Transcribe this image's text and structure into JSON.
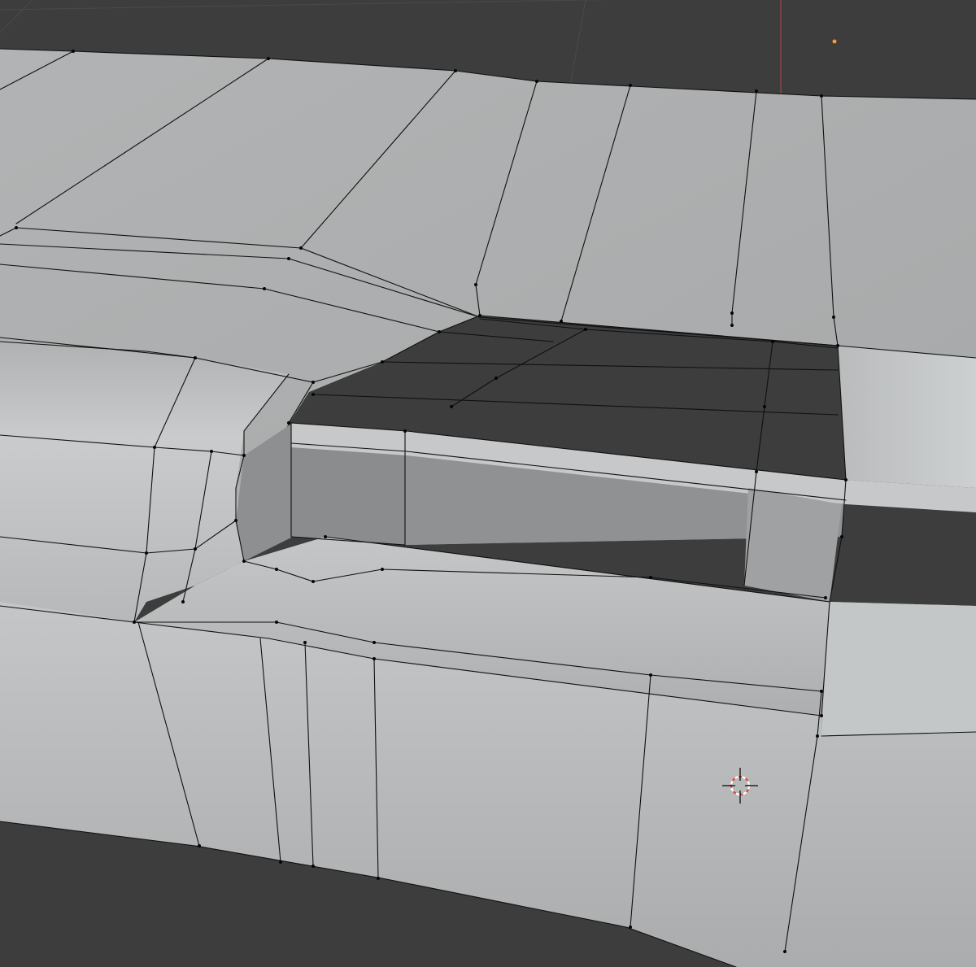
{
  "viewport": {
    "mode": "edit-mode-3d-viewport",
    "shading": "solid",
    "colors": {
      "background": "#3d3d3d",
      "grid_line": "#4a4a4a",
      "axis_x_line": "#9a4a4a",
      "mesh_light": "#c2c4c5",
      "mesh_mid": "#a7a9aa",
      "mesh_dark": "#888a8b",
      "edge": "#101010",
      "vertex": "#050505",
      "origin_dot": "#ff9a2e",
      "cursor_red": "#e8423a",
      "cursor_white": "#ffffff"
    },
    "icons": [
      "origin-dot",
      "3d-cursor-icon"
    ]
  }
}
